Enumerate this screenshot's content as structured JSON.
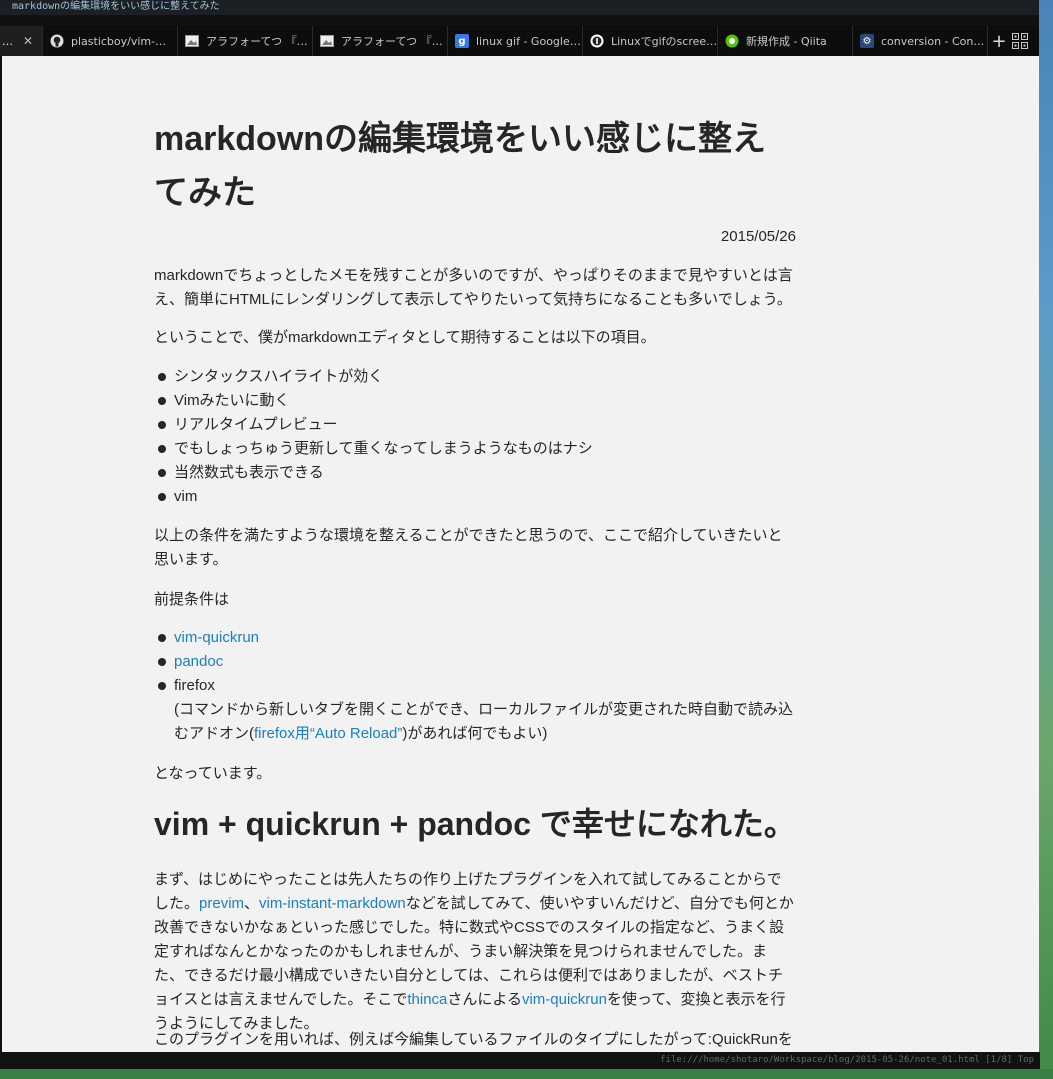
{
  "window": {
    "title": "markdownの編集環境をいい感じに整えてみた"
  },
  "tabs": [
    {
      "label": "…",
      "icon": "ellipsis-icon",
      "active": true,
      "show_close": true
    },
    {
      "label": "plasticboy/vim-…",
      "icon": "github-icon",
      "color": "#333333"
    },
    {
      "label": "アラフォーてつ 『…",
      "icon": "image-icon",
      "color": "#555555"
    },
    {
      "label": "アラフォーてつ 『…",
      "icon": "image-icon",
      "color": "#555555"
    },
    {
      "label": "linux gif - Google…",
      "icon": "google-icon",
      "color": "#3b78e7"
    },
    {
      "label": "Linuxでgifのscree…",
      "icon": "info-icon",
      "color": "#222222"
    },
    {
      "label": "新規作成 - Qiita",
      "icon": "qiita-icon",
      "color": "#55c500"
    },
    {
      "label": "conversion - Con…",
      "icon": "stackexchange-icon",
      "color": "#2b4a7a"
    }
  ],
  "tab_new_label": "+",
  "statusbar": {
    "url": "file:///home/shotaro/Workspace/blog/2015-05-26/note_01.html [1/8] Top"
  },
  "article": {
    "title": "markdownの編集環境をいい感じに整えてみた",
    "date": "2015/05/26",
    "intro": "markdownでちょっとしたメモを残すことが多いのですが、やっぱりそのままで見やすいとは言え、簡単にHTMLにレンダリングして表示してやりたいって気持ちになることも多いでしょう。",
    "expect": "ということで、僕がmarkdownエディタとして期待することは以下の項目。",
    "requirements": [
      "シンタックスハイライトが効く",
      "Vimみたいに動く",
      "リアルタイムプレビュー",
      "でもしょっちゅう更新して重くなってしまうようなものはナシ",
      "当然数式も表示できる",
      "vim"
    ],
    "summary": "以上の条件を満たすような環境を整えることができたと思うので、ここで紹介していきたいと思います。",
    "prereq_heading": "前提条件は",
    "prereq_links": [
      "vim-quickrun",
      "pandoc"
    ],
    "prereq_firefox": "firefox",
    "prereq_note_before": "(コマンドから新しいタブを開くことができ、ローカルファイルが変更された時自動で読み込むアドオン(",
    "prereq_note_link": "firefox用“Auto Reload”",
    "prereq_note_after": ")があれば何でもよい)",
    "prereq_end": "となっています。",
    "section_title": "vim + quickrun + pandoc で幸せになれた。",
    "section_p1_a": "まず、はじめにやったことは先人たちの作り上げたプラグインを入れて試してみることからでした。",
    "section_p1_link1": "previm",
    "section_p1_sep": "、",
    "section_p1_link2": "vim-instant-markdown",
    "section_p1_b": "などを試してみて、使いやすいんだけど、自分でも何とか改善できないかなぁといった感じでした。特に数式やCSSでのスタイルの指定など、うまく設定すればなんとかなったのかもしれませんが、うまい解決策を見つけられませんでした。また、できるだけ最小構成でいきたい自分としては、これらは便利ではありましたが、ベストチョイスとは言えませんでした。そこで",
    "section_p1_link3": "thinca",
    "section_p1_c": "さんによる",
    "section_p1_link4": "vim-quickrun",
    "section_p1_d": "を使って、変換と表示を行うようにしてみました。",
    "section_p2": "このプラグインを用いれば、例えば今編集しているファイルのタイプにしたがって:QuickRunを実"
  }
}
